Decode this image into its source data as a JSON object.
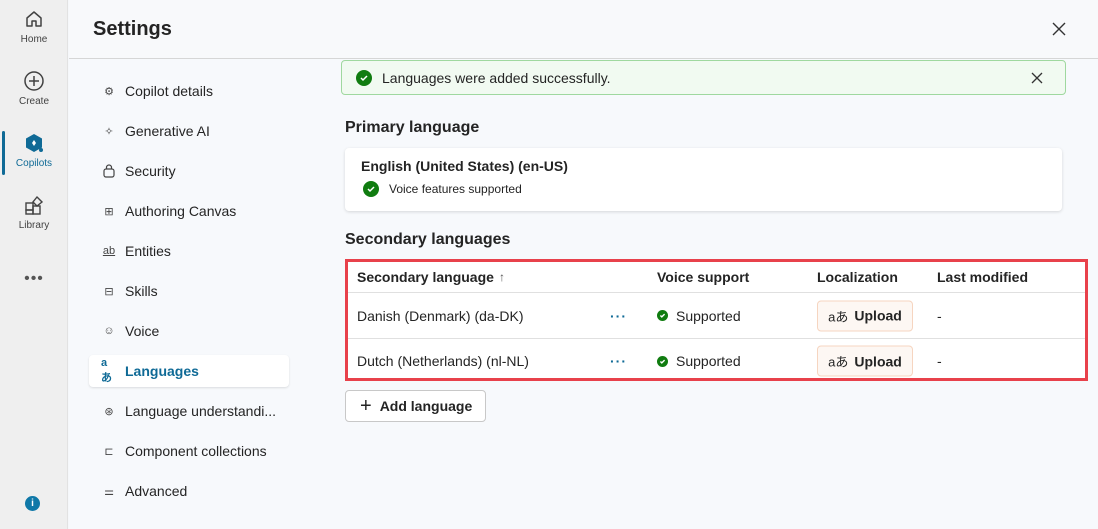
{
  "rail": {
    "items": [
      {
        "label": "Home",
        "icon": "home-icon"
      },
      {
        "label": "Create",
        "icon": "add-circle-icon"
      },
      {
        "label": "Copilots",
        "icon": "copilot-icon",
        "active": true
      },
      {
        "label": "Library",
        "icon": "library-icon"
      }
    ],
    "more_label": "•••",
    "info_label": "i"
  },
  "header": {
    "title": "Settings"
  },
  "nav": {
    "items": [
      {
        "label": "Copilot details",
        "icon": "gear-icon",
        "glyph": "⚙"
      },
      {
        "label": "Generative AI",
        "icon": "sparkle-icon",
        "glyph": "✧"
      },
      {
        "label": "Security",
        "icon": "lock-icon",
        "glyph": "🔒"
      },
      {
        "label": "Authoring Canvas",
        "icon": "grid-icon",
        "glyph": "⊞"
      },
      {
        "label": "Entities",
        "icon": "entity-icon",
        "glyph": "ab"
      },
      {
        "label": "Skills",
        "icon": "briefcase-icon",
        "glyph": "⊟"
      },
      {
        "label": "Voice",
        "icon": "voice-icon",
        "glyph": "☺"
      },
      {
        "label": "Languages",
        "icon": "translate-icon",
        "glyph": "aあ",
        "active": true
      },
      {
        "label": "Language understandi...",
        "icon": "brain-icon",
        "glyph": "⊛"
      },
      {
        "label": "Component collections",
        "icon": "collection-icon",
        "glyph": "⊏"
      },
      {
        "label": "Advanced",
        "icon": "sliders-icon",
        "glyph": "⚌"
      }
    ]
  },
  "toast": {
    "message": "Languages were added successfully."
  },
  "primary": {
    "heading": "Primary language",
    "name": "English (United States) (en-US)",
    "voice": "Voice features supported"
  },
  "secondary": {
    "heading": "Secondary languages",
    "columns": [
      "Secondary language",
      "Voice support",
      "Localization",
      "Last modified"
    ],
    "sort_glyph": "↑",
    "more_glyph": "···",
    "rows": [
      {
        "language": "Danish (Denmark) (da-DK)",
        "voice": "Supported",
        "localization": "Upload",
        "modified": "-"
      },
      {
        "language": "Dutch (Netherlands) (nl-NL)",
        "voice": "Supported",
        "localization": "Upload",
        "modified": "-"
      }
    ],
    "upload_glyph": "aあ",
    "add_label": "Add language"
  }
}
